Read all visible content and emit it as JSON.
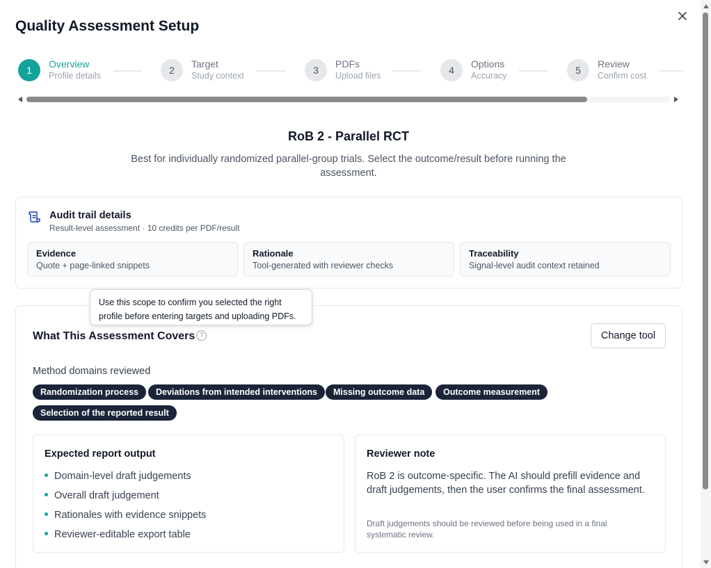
{
  "modal": {
    "title": "Quality Assessment Setup",
    "close_icon": "close-icon"
  },
  "stepper": {
    "steps": [
      {
        "number": "1",
        "label": "Overview",
        "sub": "Profile details",
        "active": true
      },
      {
        "number": "2",
        "label": "Target",
        "sub": "Study context",
        "active": false
      },
      {
        "number": "3",
        "label": "PDFs",
        "sub": "Upload files",
        "active": false
      },
      {
        "number": "4",
        "label": "Options",
        "sub": "Accuracy",
        "active": false
      },
      {
        "number": "5",
        "label": "Review",
        "sub": "Confirm cost",
        "active": false
      }
    ]
  },
  "tool": {
    "name": "RoB 2 - Parallel RCT",
    "description": "Best for individually randomized parallel-group trials. Select the outcome/result before running the assessment."
  },
  "audit": {
    "icon": "scroll-icon",
    "title": "Audit trail details",
    "subtitle": "Result-level assessment · 10 credits per PDF/result",
    "items": [
      {
        "heading": "Evidence",
        "value": "Quote + page-linked snippets"
      },
      {
        "heading": "Rationale",
        "value": "Tool-generated with reviewer checks"
      },
      {
        "heading": "Traceability",
        "value": "Signal-level audit context retained"
      }
    ]
  },
  "tooltip": {
    "text": "Use this scope to confirm you selected the right profile before entering targets and uploading PDFs."
  },
  "covers": {
    "title": "What This Assessment Covers",
    "help_icon": "question-circle-icon",
    "help_glyph": "?",
    "change_button": "Change tool",
    "domains_label": "Method domains reviewed",
    "domains": [
      "Randomization process",
      "Deviations from intended interventions",
      "Missing outcome data",
      "Outcome measurement",
      "Selection of the reported result"
    ],
    "expected": {
      "title": "Expected report output",
      "items": [
        "Domain-level draft judgements",
        "Overall draft judgement",
        "Rationales with evidence snippets",
        "Reviewer-editable export table"
      ]
    },
    "note": {
      "title": "Reviewer note",
      "body": "RoB 2 is outcome-specific. The AI should prefill evidence and draft judgements, then the user confirms the final assessment.",
      "fine": "Draft judgements should be reviewed before being used in a final systematic review."
    }
  },
  "colors": {
    "accent": "#14a39a",
    "chip_bg": "#1b2438",
    "border": "#e5e7eb"
  }
}
